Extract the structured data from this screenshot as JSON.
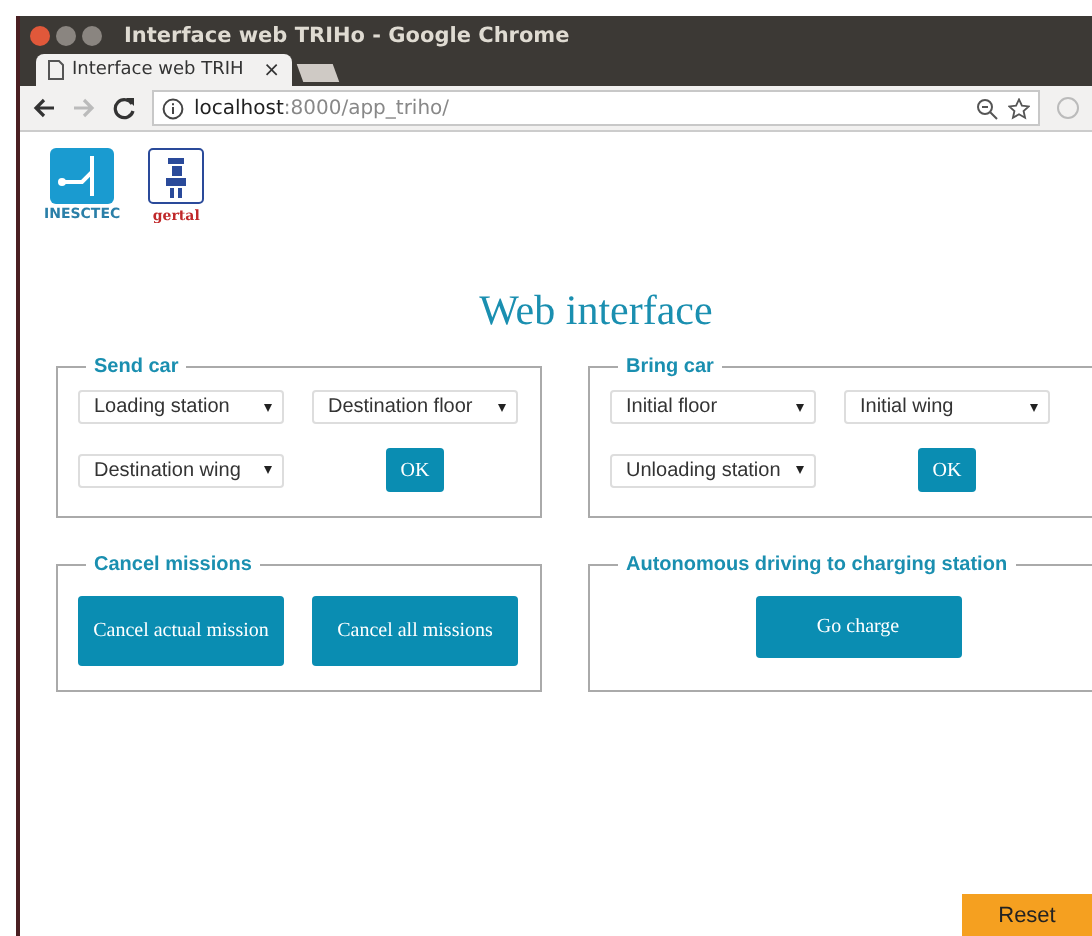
{
  "window": {
    "title": "Interface web TRIHo - Google Chrome"
  },
  "tabs": [
    {
      "label": "Interface web TRIH",
      "close": "×",
      "selected": true
    }
  ],
  "address_bar": {
    "host": "localhost",
    "path": ":8000/app_triho/"
  },
  "logos": [
    {
      "text": "INESCTEC"
    },
    {
      "text": "gertal"
    }
  ],
  "heading": "Web interface",
  "panels": [
    {
      "title": "Send car",
      "kind": "form",
      "selects": [
        "Loading station",
        "Destination floor",
        "Destination wing"
      ],
      "button": "OK"
    },
    {
      "title": "Bring car",
      "kind": "form",
      "selects": [
        "Initial floor",
        "Initial wing",
        "Unloading station"
      ],
      "button": "OK"
    },
    {
      "title": "Cancel missions",
      "kind": "actions",
      "buttons": [
        "Cancel actual mission",
        "Cancel all missions"
      ]
    },
    {
      "title": "Autonomous driving to charging station",
      "kind": "actions",
      "buttons": [
        "Go charge"
      ]
    }
  ],
  "reset_button": "Reset"
}
